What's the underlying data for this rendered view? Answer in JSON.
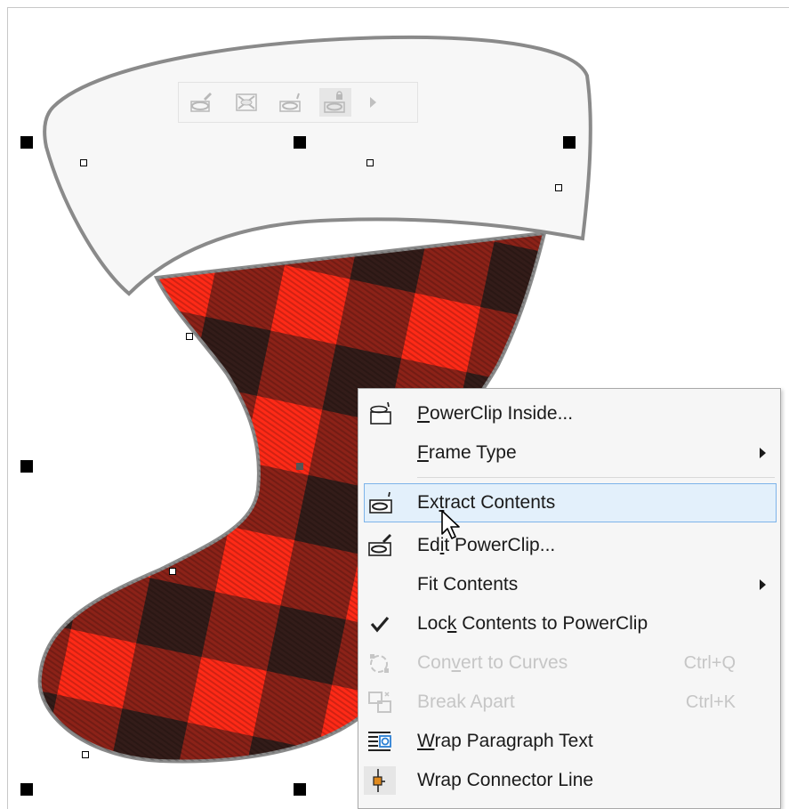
{
  "floating_toolbar": {
    "buttons": [
      {
        "icon": "edit-powerclip-icon"
      },
      {
        "icon": "select-contents-icon"
      },
      {
        "icon": "extract-contents-icon"
      },
      {
        "icon": "lock-contents-icon"
      },
      {
        "icon": "more-arrow-icon"
      }
    ]
  },
  "artwork": {
    "cuff_color": "#f7f7f7",
    "outline_color": "#8a8a8a",
    "plaid_red": "#ff2a17",
    "plaid_black": "#1a1a1a"
  },
  "context_menu": {
    "items": [
      {
        "pre": "",
        "u": "P",
        "post": "owerClip Inside...",
        "shortcut": "",
        "submenu": false,
        "disabled": false,
        "icon": "powerclip-inside-icon"
      },
      {
        "pre": "",
        "u": "F",
        "post": "rame Type",
        "shortcut": "",
        "submenu": true,
        "disabled": false,
        "icon": ""
      },
      {
        "pre": "Ex",
        "u": "t",
        "post": "ract Contents",
        "shortcut": "",
        "submenu": false,
        "disabled": false,
        "icon": "extract-contents-icon",
        "highlighted": true
      },
      {
        "pre": "Ed",
        "u": "i",
        "post": "t PowerClip...",
        "shortcut": "",
        "submenu": false,
        "disabled": false,
        "icon": "edit-powerclip-icon"
      },
      {
        "pre": "Fit Contents",
        "u": "",
        "post": "",
        "shortcut": "",
        "submenu": true,
        "disabled": false,
        "icon": ""
      },
      {
        "pre": "Loc",
        "u": "k",
        "post": " Contents to PowerClip",
        "shortcut": "",
        "submenu": false,
        "disabled": false,
        "icon": "checkmark-icon"
      },
      {
        "pre": "Con",
        "u": "v",
        "post": "ert to Curves",
        "shortcut": "Ctrl+Q",
        "submenu": false,
        "disabled": true,
        "icon": "convert-to-curves-icon"
      },
      {
        "pre": "Break Apart",
        "u": "",
        "post": "",
        "shortcut": "Ctrl+K",
        "submenu": false,
        "disabled": true,
        "icon": "break-apart-icon"
      },
      {
        "pre": "",
        "u": "W",
        "post": "rap Paragraph Text",
        "shortcut": "",
        "submenu": false,
        "disabled": false,
        "icon": "wrap-paragraph-text-icon"
      },
      {
        "pre": "Wrap Connector Line",
        "u": "",
        "post": "",
        "shortcut": "",
        "submenu": false,
        "disabled": false,
        "icon": "wrap-connector-line-icon"
      }
    ]
  }
}
